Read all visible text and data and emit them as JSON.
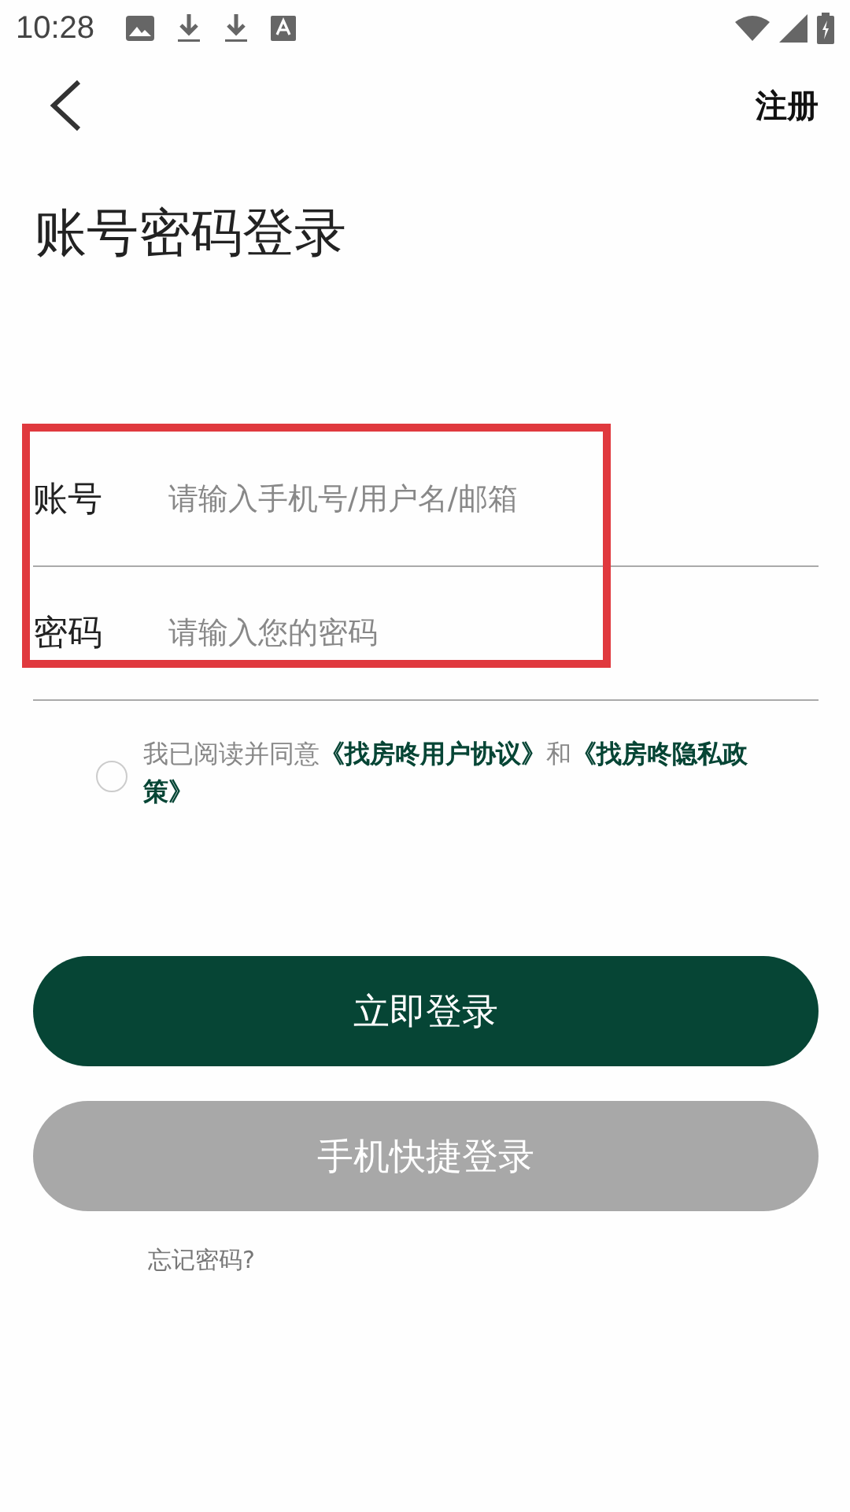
{
  "status_bar": {
    "time": "10:28",
    "notifications": [
      {
        "kind": "image"
      },
      {
        "kind": "download"
      },
      {
        "kind": "download"
      },
      {
        "kind": "text"
      }
    ]
  },
  "header": {
    "action": "注册"
  },
  "title": "账号密码登录",
  "form": {
    "highlighted": true,
    "fields": [
      {
        "label": "账号",
        "placeholder": "请输入手机号/用户名/邮箱"
      },
      {
        "label": "密码",
        "placeholder": "请输入您的密码"
      }
    ]
  },
  "agreement": {
    "checked": false,
    "text": "我已阅读并同意**《找房咚用户协议》**和**《找房咚隐私政策》**"
  },
  "buttons": [
    {
      "label": "立即登录",
      "disabled": false
    },
    {
      "label": "手机快捷登录",
      "disabled": true
    }
  ],
  "forgot_link": "忘记密码?"
}
